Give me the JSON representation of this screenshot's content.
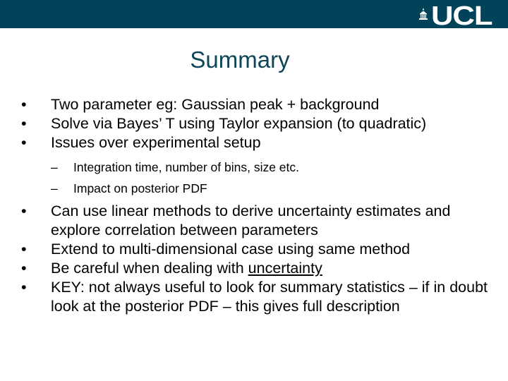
{
  "header": {
    "logo_text": "UCL",
    "logo_icon": "portico-dome-icon",
    "bar_color": "#024359"
  },
  "slide": {
    "title": "Summary",
    "title_color": "#0e4559",
    "bullets_group1": [
      "Two parameter eg: Gaussian peak + background",
      "Solve via Bayes’ T using Taylor expansion (to quadratic)",
      "Issues over experimental setup"
    ],
    "sub_bullets": [
      "Integration time, number of bins, size etc.",
      "Impact on posterior PDF"
    ],
    "bullets_group2": [
      "Can use linear methods to derive uncertainty estimates and explore correlation between parameters",
      "Extend to multi-dimensional case using same method"
    ],
    "bullet_careful": {
      "prefix": "Be careful when dealing with ",
      "underlined": "uncertainty"
    },
    "bullet_key": "KEY: not always useful to look for summary statistics – if in doubt look at the posterior PDF – this gives full description"
  }
}
